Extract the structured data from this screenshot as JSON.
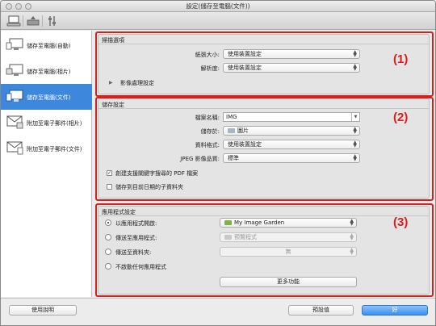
{
  "window": {
    "title": "設定(儲存至電腦(文件))"
  },
  "toolbar": {
    "buttons": [
      {
        "name": "scan-from-computer-icon"
      },
      {
        "name": "scan-from-operation-panel-icon"
      },
      {
        "name": "general-settings-icon"
      }
    ]
  },
  "sidebar": {
    "items": [
      {
        "label": "儲存至電腦(自動)",
        "selected": false,
        "icon": "computer-auto-icon"
      },
      {
        "label": "儲存至電腦(相片)",
        "selected": false,
        "icon": "computer-photo-icon"
      },
      {
        "label": "儲存至電腦(文件)",
        "selected": true,
        "icon": "computer-document-icon"
      },
      {
        "label": "附加至電子郵件(相片)",
        "selected": false,
        "icon": "email-photo-icon"
      },
      {
        "label": "附加至電子郵件(文件)",
        "selected": false,
        "icon": "email-document-icon"
      }
    ]
  },
  "scan_options": {
    "title": "掃描選項",
    "paper_size_label": "紙張大小:",
    "paper_size_value": "使用裝置設定",
    "resolution_label": "解析度:",
    "resolution_value": "使用裝置設定",
    "image_processing_label": "影像處理設定",
    "callout": "(1)"
  },
  "save_settings": {
    "title": "儲存設定",
    "file_name_label": "檔案名稱:",
    "file_name_value": "IMG",
    "save_in_label": "儲存於:",
    "save_in_value": "圖片",
    "data_format_label": "資料格式:",
    "data_format_value": "使用裝置設定",
    "jpeg_quality_label": "JPEG 影像品質:",
    "jpeg_quality_value": "標準",
    "create_pdf_label": "創建支援關鍵字搜尋的 PDF 檔案",
    "create_pdf_checked": true,
    "save_subfolder_label": "儲存到目前日期的子資料夾",
    "save_subfolder_checked": false,
    "callout": "(2)"
  },
  "app_settings": {
    "title": "應用程式設定",
    "open_with_label": "以應用程式開啟:",
    "open_with_value": "My Image Garden",
    "send_to_app_label": "傳送至應用程式:",
    "send_to_app_value": "預覽程式",
    "send_to_folder_label": "傳送至資料夾:",
    "send_to_folder_value": "無",
    "do_not_start_label": "不啟動任何應用程式",
    "more_functions_label": "更多功能",
    "selected_option": "open_with",
    "callout": "(3)"
  },
  "footer": {
    "help_label": "使用說明",
    "defaults_label": "預設值",
    "ok_label": "好"
  },
  "colors": {
    "accent": "#3d87dd",
    "callout": "#d91e1e"
  }
}
